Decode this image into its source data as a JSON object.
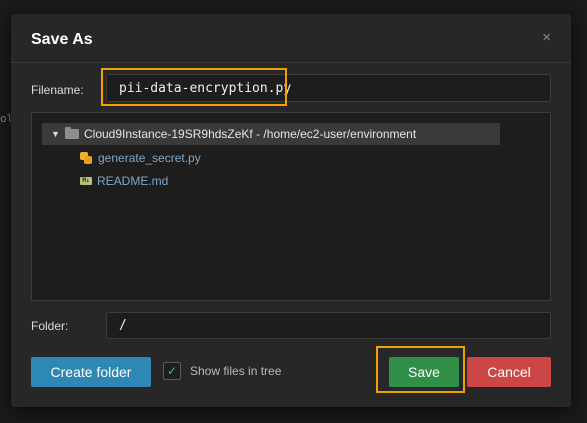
{
  "background": {
    "snippet": "ol"
  },
  "dialog": {
    "title": "Save As",
    "close_glyph": "×",
    "filename": {
      "label": "Filename:",
      "value": "pii-data-encryption.py"
    },
    "tree": {
      "root": {
        "label": "Cloud9Instance-19SR9hdsZeKf - /home/ec2-user/environment",
        "icon": "folder-icon",
        "expanded_glyph": "▼"
      },
      "items": [
        {
          "label": "generate_secret.py",
          "icon": "python-file-icon"
        },
        {
          "label": "README.md",
          "icon": "markdown-file-icon",
          "icon_text": "M↓"
        }
      ]
    },
    "folder": {
      "label": "Folder:",
      "value": "/"
    },
    "create_folder_label": "Create folder",
    "show_files": {
      "label": "Show files in tree",
      "checked": true,
      "check_glyph": "✓"
    },
    "save_label": "Save",
    "cancel_label": "Cancel",
    "colors": {
      "highlight": "#f0a000",
      "create": "#2e88b4",
      "save": "#2f8f47",
      "cancel": "#cc4646"
    }
  }
}
